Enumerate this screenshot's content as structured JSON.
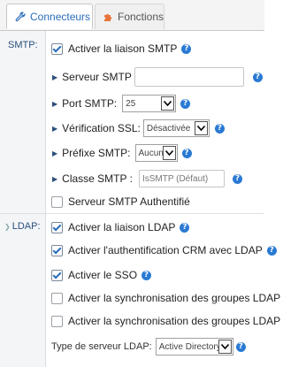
{
  "tabs": [
    {
      "label": "Connecteurs",
      "icon": "wrench-icon",
      "active": true
    },
    {
      "label": "Fonctions",
      "icon": "puzzle-icon",
      "active": false
    }
  ],
  "smtp": {
    "section_label": "SMTP:",
    "enable_label": "Activer la liaison SMTP",
    "server_label": "Serveur SMTP",
    "server_value": "",
    "port_label": "Port SMTP:",
    "port_value": "25",
    "ssl_label": "Vérification SSL:",
    "ssl_value": "Désactivée",
    "prefix_label": "Préfixe SMTP:",
    "prefix_value": "Aucun",
    "class_label": "Classe SMTP :",
    "class_value": "IsSMTP (Défaut)",
    "auth_label": "Serveur SMTP Authentifié"
  },
  "ldap": {
    "section_label": "LDAP:",
    "enable_label": "Activer la liaison LDAP",
    "crm_auth_label": "Activer l'authentification CRM avec LDAP",
    "sso_label": "Activer le SSO",
    "sync_groups_label_1": "Activer la synchronisation des groupes LDAP d",
    "sync_groups_label_2": "Activer la synchronisation des groupes LDAP d",
    "server_type_label": "Type de serveur LDAP:",
    "server_type_value": "Active Directory"
  },
  "colors": {
    "accent": "#2a7ad4",
    "tab_active_text": "#2a6ebb",
    "section_text": "#2a4f7a"
  }
}
